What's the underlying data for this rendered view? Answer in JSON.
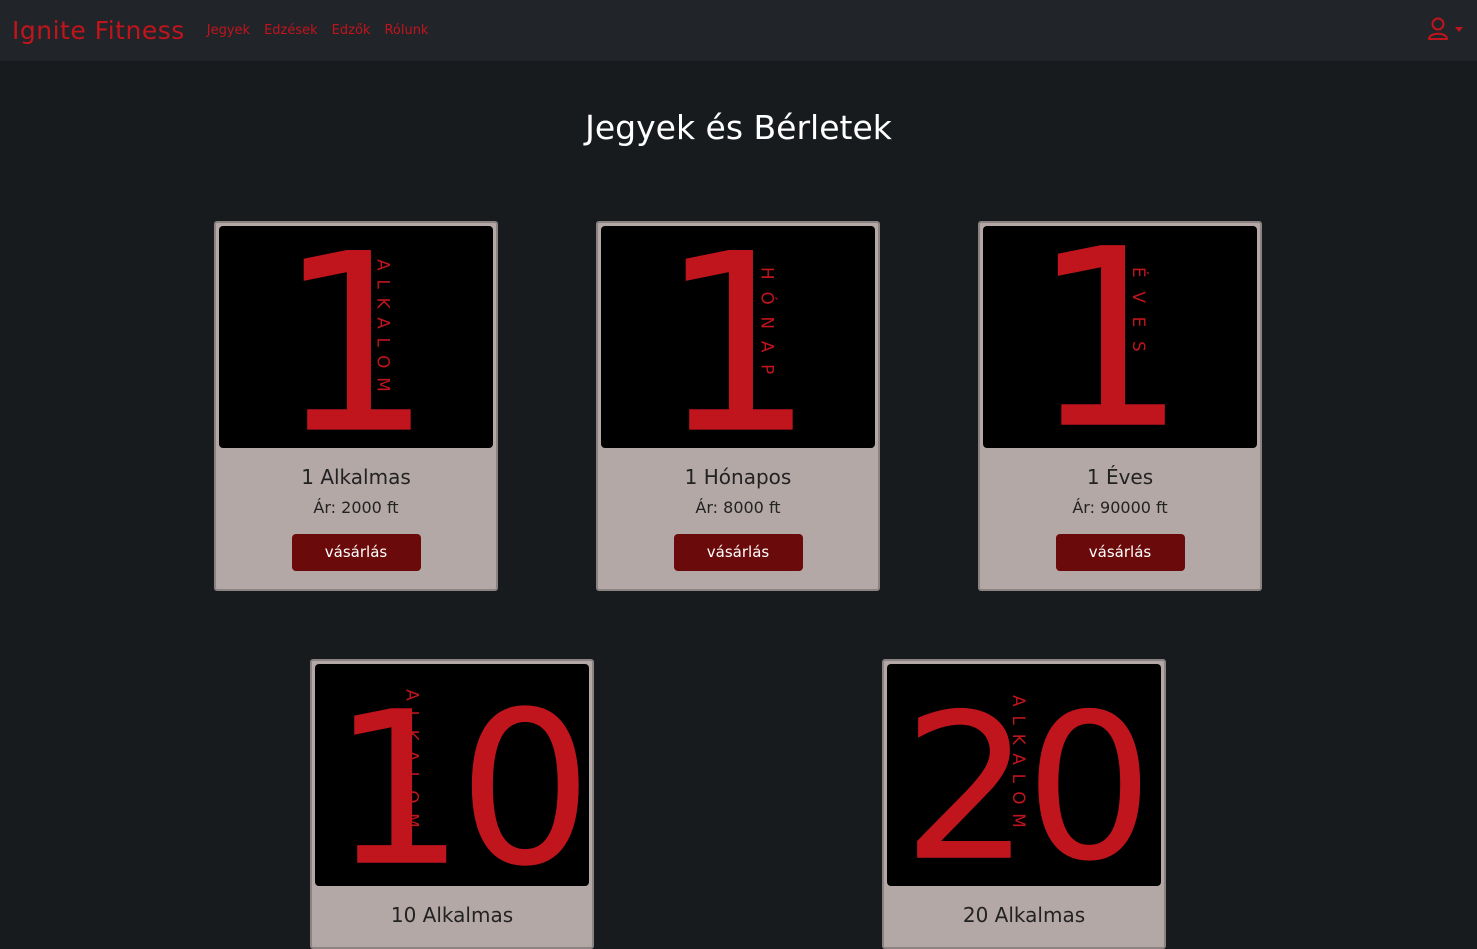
{
  "nav": {
    "brand": "Ignite Fitness",
    "links": [
      "Jegyek",
      "Edzések",
      "Edzők",
      "Rólunk"
    ]
  },
  "page_title": "Jegyek és Bérletek",
  "buy_label": "vásárlás",
  "cards": [
    {
      "number": "1",
      "side_text": "ALKALOM",
      "title": "1 Alkalmas",
      "price": "Ár: 2000 ft"
    },
    {
      "number": "1",
      "side_text": "HÓNAP",
      "title": "1 Hónapos",
      "price": "Ár: 8000 ft"
    },
    {
      "number": "1",
      "side_text": "ÉVES",
      "title": "1 Éves",
      "price": "Ár: 90000 ft"
    },
    {
      "number": "10",
      "side_text": "ALKALOM",
      "title": "10 Alkalmas"
    },
    {
      "number": "20",
      "side_text": "ALKALOM",
      "title": "20 Alkalmas"
    }
  ],
  "colors": {
    "accent": "#c0151c",
    "button": "#6b0a0a",
    "card": "#b3a8a6",
    "background": "#181b1e"
  },
  "icons": {
    "user": "user-icon",
    "caret": "caret-down-icon"
  }
}
